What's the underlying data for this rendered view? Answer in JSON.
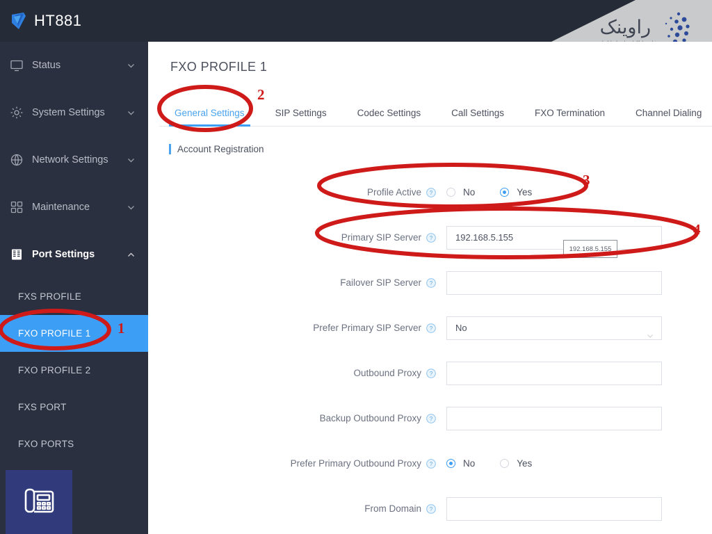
{
  "brand": {
    "name": "HT881",
    "logo_icon": "grandstream-logo-icon"
  },
  "sidebar": {
    "groups": [
      {
        "label": "Status",
        "icon": "monitor-icon",
        "chevron": "chevron-down-icon",
        "expanded": false
      },
      {
        "label": "System Settings",
        "icon": "gear-icon",
        "chevron": "chevron-down-icon",
        "expanded": false
      },
      {
        "label": "Network Settings",
        "icon": "globe-icon",
        "chevron": "chevron-down-icon",
        "expanded": false
      },
      {
        "label": "Maintenance",
        "icon": "grid-squares-icon",
        "chevron": "chevron-down-icon",
        "expanded": false
      },
      {
        "label": "Port Settings",
        "icon": "ports-icon",
        "chevron": "chevron-up-icon",
        "expanded": true
      }
    ],
    "sub_items": [
      {
        "label": "FXS PROFILE",
        "selected": false
      },
      {
        "label": "FXO PROFILE 1",
        "selected": true
      },
      {
        "label": "FXO PROFILE 2",
        "selected": false
      },
      {
        "label": "FXS PORT",
        "selected": false
      },
      {
        "label": "FXO PORTS",
        "selected": false
      }
    ],
    "badge_icon": "desk-phone-icon"
  },
  "watermark": {
    "word": "راوینک",
    "subtitle": "فناوری اطلاعات راوند ارتباط رایتیس",
    "dots_icon": "dot-cluster-icon"
  },
  "main": {
    "page_title": "FXO PROFILE 1",
    "tabs": [
      {
        "label": "General Settings",
        "active": true
      },
      {
        "label": "SIP Settings",
        "active": false
      },
      {
        "label": "Codec Settings",
        "active": false
      },
      {
        "label": "Call Settings",
        "active": false
      },
      {
        "label": "FXO Termination",
        "active": false
      },
      {
        "label": "Channel Dialing",
        "active": false
      }
    ],
    "section_title": "Account Registration",
    "tooltip_text": "192.168.5.155",
    "fields": [
      {
        "label": "Profile Active",
        "type": "radio",
        "help_icon": "help-circle-icon",
        "options": [
          {
            "label": "No",
            "selected": false
          },
          {
            "label": "Yes",
            "selected": true
          }
        ]
      },
      {
        "label": "Primary SIP Server",
        "type": "text",
        "help_icon": "help-circle-icon",
        "value": "192.168.5.155",
        "placeholder": ""
      },
      {
        "label": "Failover SIP Server",
        "type": "text",
        "help_icon": "help-circle-icon",
        "value": "",
        "placeholder": ""
      },
      {
        "label": "Prefer Primary SIP Server",
        "type": "select",
        "help_icon": "help-circle-icon",
        "value": "No",
        "caret_icon": "chevron-down-icon"
      },
      {
        "label": "Outbound Proxy",
        "type": "text",
        "help_icon": "help-circle-icon",
        "value": "",
        "placeholder": ""
      },
      {
        "label": "Backup Outbound Proxy",
        "type": "text",
        "help_icon": "help-circle-icon",
        "value": "",
        "placeholder": ""
      },
      {
        "label": "Prefer Primary Outbound Proxy",
        "type": "radio",
        "help_icon": "help-circle-icon",
        "options": [
          {
            "label": "No",
            "selected": true
          },
          {
            "label": "Yes",
            "selected": false
          }
        ]
      },
      {
        "label": "From Domain",
        "type": "text",
        "help_icon": "help-circle-icon",
        "value": "",
        "placeholder": ""
      }
    ]
  },
  "annotations": {
    "color": "#cf1a1a",
    "markers": [
      {
        "number": "1",
        "target": "sidebar-item-fxo-profile-1"
      },
      {
        "number": "2",
        "target": "tab-general-settings"
      },
      {
        "number": "3",
        "target": "field-profile-active"
      },
      {
        "number": "4",
        "target": "field-primary-sip-server"
      }
    ]
  },
  "colors": {
    "sidebar_bg": "#2b3040",
    "header_bg": "#262b38",
    "accent_blue": "#3d9ef5",
    "annotation_red": "#cf1a1a"
  }
}
